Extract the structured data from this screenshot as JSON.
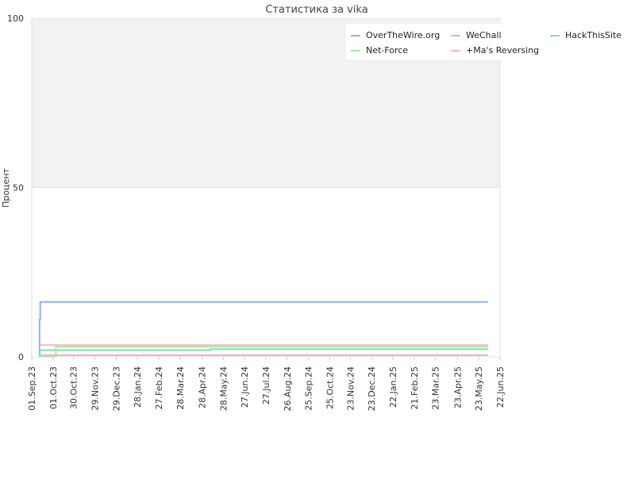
{
  "chart_data": {
    "type": "line",
    "title": "Статистика за vika",
    "ylabel": "Процент",
    "xlabel": "",
    "ylim": [
      0,
      100
    ],
    "y_ticks": [
      "0",
      "50",
      "100"
    ],
    "x_ticks": [
      "01.Sep.23",
      "01.Oct.23",
      "30.Oct.23",
      "29.Nov.23",
      "29.Dec.23",
      "28.Jan.24",
      "27.Feb.24",
      "28.Mar.24",
      "28.Apr.24",
      "28.May.24",
      "27.Jun.24",
      "27.Jul.24",
      "26.Aug.24",
      "25.Sep.24",
      "25.Oct.24",
      "23.Nov.24",
      "23.Dec.24",
      "22.Jan.25",
      "21.Feb.25",
      "23.Mar.25",
      "23.Apr.25",
      "23.May.25",
      "22.Jun.25"
    ],
    "grid": true,
    "legend_position": "top-right",
    "series": [
      {
        "name": "OverTheWire.org",
        "color": "#8ab4f0",
        "points": [
          [
            "2023-09-12",
            0
          ],
          [
            "2023-09-12",
            11
          ],
          [
            "2023-09-13",
            11
          ],
          [
            "2023-09-13",
            16.2
          ],
          [
            "2025-06-05",
            16.2
          ]
        ]
      },
      {
        "name": "WeChall",
        "color": "#f0a8c8",
        "points": [
          [
            "2023-09-12",
            0.3
          ],
          [
            "2023-09-13",
            0.5
          ],
          [
            "2025-06-05",
            0.5
          ]
        ]
      },
      {
        "name": "HackThisSite",
        "color": "#7ee0b0",
        "points": [
          [
            "2023-09-12",
            0.2
          ],
          [
            "2023-09-13",
            2.0
          ],
          [
            "2024-05-10",
            2.0
          ],
          [
            "2024-05-10",
            2.3
          ],
          [
            "2025-06-05",
            2.3
          ]
        ]
      },
      {
        "name": "Net-Force",
        "color": "#a8e8a0",
        "points": [
          [
            "2023-09-12",
            0.2
          ],
          [
            "2023-10-05",
            0.2
          ],
          [
            "2023-10-05",
            3.0
          ],
          [
            "2025-06-05",
            3.0
          ]
        ]
      },
      {
        "name": "+Ma's Reversing",
        "color": "#f8b8c0",
        "points": [
          [
            "2023-09-12",
            3.5
          ],
          [
            "2025-06-05",
            3.5
          ]
        ]
      }
    ]
  }
}
